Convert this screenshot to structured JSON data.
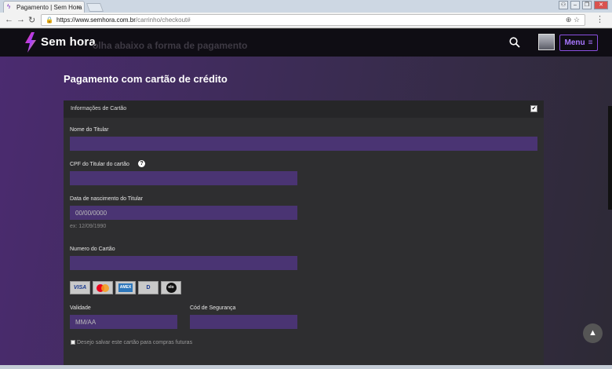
{
  "browser": {
    "tab_title": "Pagamento | Sem Hora",
    "tab_close": "×",
    "url_host": "https://www.semhora.com.br",
    "url_path": "/carrinho/checkout#"
  },
  "header": {
    "logo_text": "Sem hora",
    "ghost_text": "olha abaixo a forma de pagamento",
    "menu_label": "Menu",
    "menu_icon": "≡"
  },
  "page": {
    "title": "Pagamento com cartão de crédito"
  },
  "card": {
    "section_label": "Informações de Cartão",
    "checked_glyph": "✔",
    "holder_name_label": "Nome do Titular",
    "holder_name_value": "",
    "cpf_label": "CPF do Titular do cartão",
    "cpf_value": "",
    "help_glyph": "?",
    "birth_label": "Data de nascimento do Titular",
    "birth_placeholder": "00/00/0000",
    "birth_hint": "ex: 12/09/1990",
    "number_label": "Numero do Cartão",
    "number_value": "",
    "brands": [
      "VISA",
      "MC",
      "AMEX",
      "D",
      "elo"
    ],
    "validity_label": "Validade",
    "validity_placeholder": "MM/AA",
    "security_label": "Cód de Segurança",
    "security_value": "",
    "save_label": "Desejo salvar este cartão para compras futuras"
  },
  "scroll_top_glyph": "▲",
  "colors": {
    "accent": "#8a4fe0",
    "field_bg": "#4a3473",
    "header_bg": "#0f0d14",
    "card_bg": "#2e2e30"
  }
}
